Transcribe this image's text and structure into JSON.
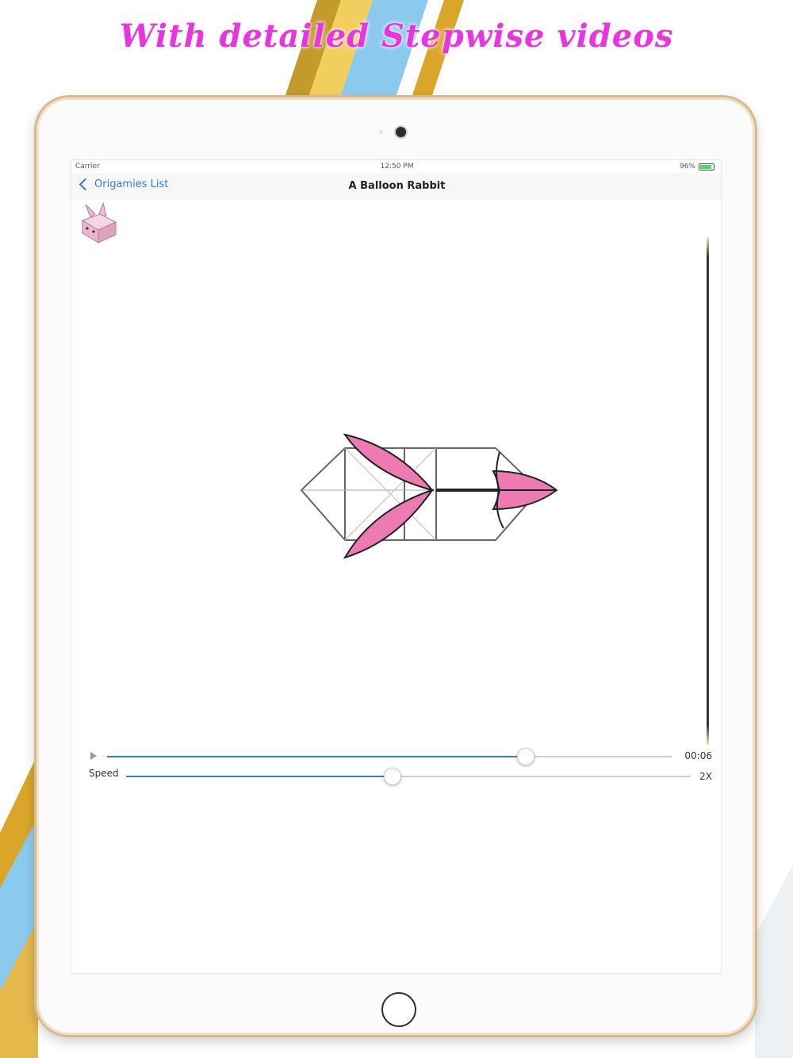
{
  "headline": "With detailed Stepwise videos",
  "status_bar": {
    "carrier": "Carrier",
    "time": "12:50 PM",
    "battery": "96%"
  },
  "nav": {
    "back_label": "Origamies List",
    "title": "A Balloon Rabbit"
  },
  "player": {
    "elapsed": "00:06",
    "progress": 0.74,
    "speed_label": "Speed",
    "speed_value": "2X",
    "speed_level": 0.47
  },
  "colors": {
    "accent": "#2f7de1",
    "headline": "#e935e0",
    "ear_pink": "#ee7ab4"
  }
}
